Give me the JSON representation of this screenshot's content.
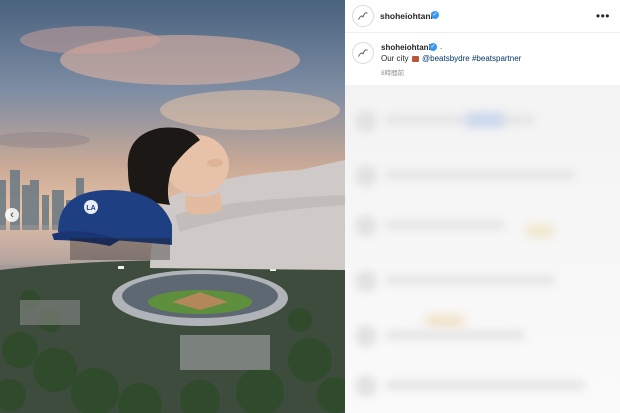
{
  "post": {
    "username": "shoheiohtani",
    "verified": true,
    "more_icon": "more-horizontal-icon",
    "caption_prefix": "Our city",
    "caption_dot": ".",
    "emoji": "city-emoji",
    "mention": "@beatsbydre",
    "hashtag": "#beatspartner",
    "time_ago": "8時間前"
  },
  "media": {
    "prev_icon": "chevron-left-icon",
    "prev_label": "‹",
    "helmet_logo": "LA"
  },
  "colors": {
    "verified_blue": "#3897f0",
    "link_blue": "#00376b",
    "helmet_navy": "#1f3f83"
  }
}
